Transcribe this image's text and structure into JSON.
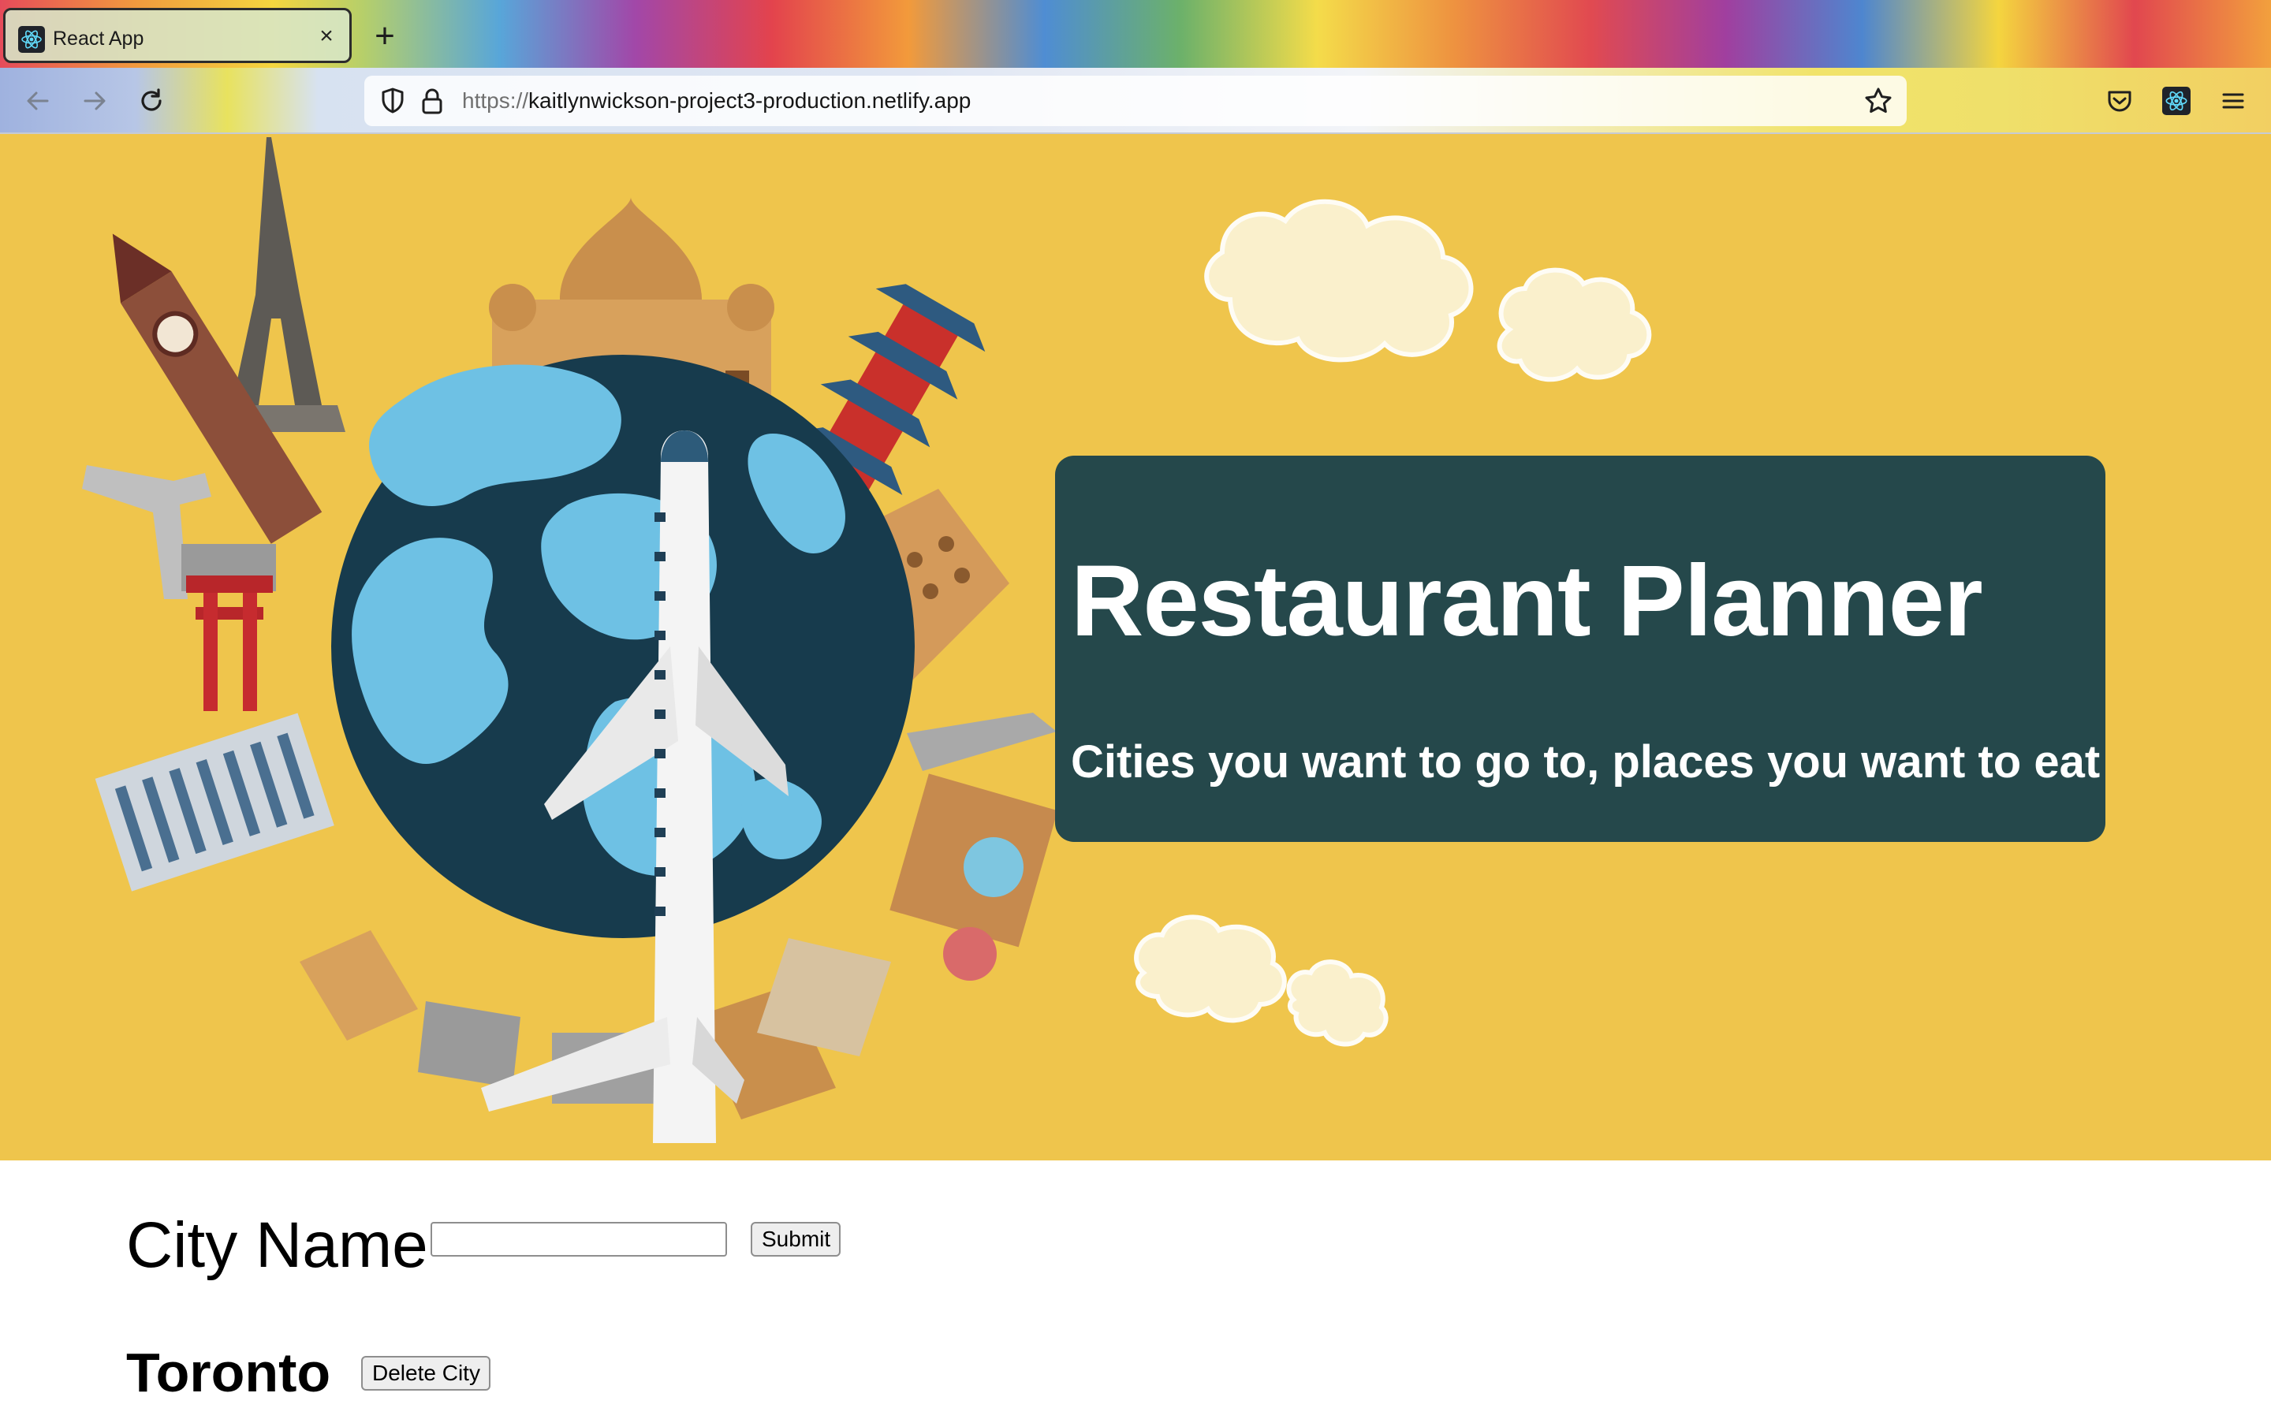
{
  "browser": {
    "tab": {
      "title": "React App",
      "close_glyph": "×"
    },
    "new_tab_glyph": "+",
    "url": {
      "protocol": "https://",
      "host": "kaitlynwickson-project3-production.netlify.app"
    },
    "icons": [
      "react-favicon-icon",
      "back-icon",
      "forward-icon",
      "reload-icon",
      "shield-icon",
      "lock-icon",
      "bookmark-star-icon",
      "pocket-icon",
      "react-devtools-icon",
      "menu-icon"
    ]
  },
  "hero": {
    "title": "Restaurant Planner",
    "subtitle": "Cities you want to go to, places you want to eat",
    "background": "#efc54c",
    "box_color": "#25484b"
  },
  "form": {
    "label": "City Name",
    "input_value": "",
    "submit_label": "Submit"
  },
  "cities": [
    {
      "name": "Toronto",
      "delete_label": "Delete City"
    }
  ]
}
